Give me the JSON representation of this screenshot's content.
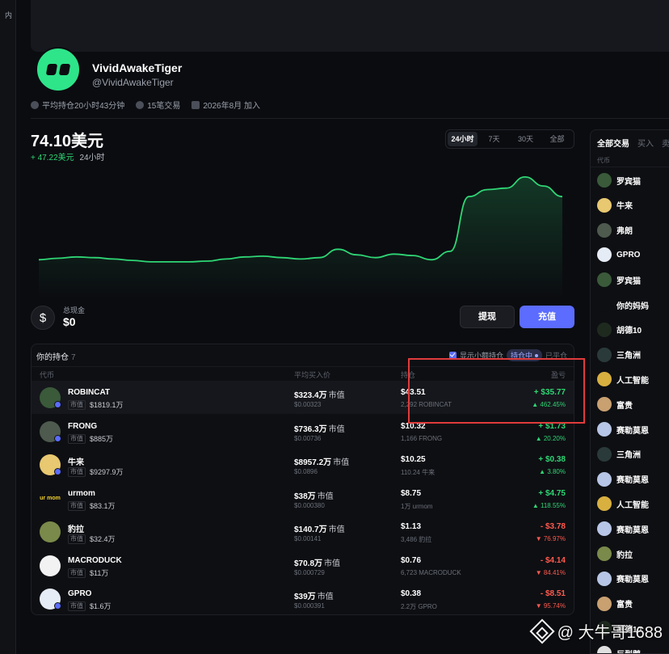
{
  "left_rail": {
    "label": "内"
  },
  "profile": {
    "name": "VividAwakeTiger",
    "handle": "@VividAwakeTiger",
    "avg_hold": "平均持仓20小时43分钟",
    "trades": "15笔交易",
    "joined": "2026年8月 加入"
  },
  "balance": {
    "value": "74.10美元",
    "change": "+ 47.22美元",
    "period": "24小时"
  },
  "range_tabs": [
    "24小时",
    "7天",
    "30天",
    "全部"
  ],
  "chart_data": {
    "type": "line",
    "y": [
      40,
      42,
      44,
      43,
      41,
      39,
      37,
      37,
      37,
      38,
      41,
      44,
      45,
      43,
      41,
      43,
      55,
      47,
      43,
      48,
      46,
      40,
      52,
      130,
      140,
      142,
      158,
      145,
      130
    ],
    "color": "#2fd675"
  },
  "cash": {
    "label": "总现金",
    "value": "$0",
    "icon": "$"
  },
  "buttons": {
    "withdraw": "提现",
    "deposit": "充值"
  },
  "holdings": {
    "title": "你的持仓",
    "count": "7",
    "show_small": "显示小额持仓",
    "filter_active": "持仓中",
    "filter_inactive": "已平仓",
    "columns": {
      "token": "代币",
      "avg": "平均买入价",
      "holding": "持仓",
      "pnl": "盈亏"
    },
    "mcap_tag": "市值",
    "mcap_suffix": "市值",
    "rows": [
      {
        "name": "ROBINCAT",
        "mcap": "$1819.1万",
        "avg": "$323.4万",
        "avg_sub": "$0.00323",
        "hold": "$43.51",
        "hold_sub": "2,292 ROBINCAT",
        "pnl": "+ $35.77",
        "pnl_pct": "▲ 462.45%",
        "sign": "pos",
        "icon_color": "#3a5a3a",
        "badge": true
      },
      {
        "name": "FRONG",
        "mcap": "$885万",
        "avg": "$736.3万",
        "avg_sub": "$0.00736",
        "hold": "$10.32",
        "hold_sub": "1,166 FRONG",
        "pnl": "+ $1.73",
        "pnl_pct": "▲ 20.20%",
        "sign": "pos",
        "icon_color": "#4d5a4d",
        "badge": true
      },
      {
        "name": "牛来",
        "mcap": "$9297.9万",
        "avg": "$8957.2万",
        "avg_sub": "$0.0896",
        "hold": "$10.25",
        "hold_sub": "110.24 牛来",
        "pnl": "+ $0.38",
        "pnl_pct": "▲ 3.80%",
        "sign": "pos",
        "icon_color": "#e8c870",
        "badge": true
      },
      {
        "name": "urmom",
        "mcap": "$83.1万",
        "avg": "$38万",
        "avg_sub": "$0.000380",
        "hold": "$8.75",
        "hold_sub": "1万 urmom",
        "pnl": "+ $4.75",
        "pnl_pct": "▲ 118.55%",
        "sign": "pos",
        "icon_color": "#0e0f13",
        "icon_text": "ur mom",
        "badge": false
      },
      {
        "name": "豹拉",
        "mcap": "$32.4万",
        "avg": "$140.7万",
        "avg_sub": "$0.00141",
        "hold": "$1.13",
        "hold_sub": "3,486 豹拉",
        "pnl": "- $3.78",
        "pnl_pct": "▼ 76.97%",
        "sign": "neg",
        "icon_color": "#7a8a4a",
        "badge": false
      },
      {
        "name": "MACRODUCK",
        "mcap": "$11万",
        "avg": "$70.8万",
        "avg_sub": "$0.000729",
        "hold": "$0.76",
        "hold_sub": "6,723 MACRODUCK",
        "pnl": "- $4.14",
        "pnl_pct": "▼ 84.41%",
        "sign": "neg",
        "icon_color": "#f2f2f2",
        "badge": false
      },
      {
        "name": "GPRO",
        "mcap": "$1.6万",
        "avg": "$39万",
        "avg_sub": "$0.000391",
        "hold": "$0.38",
        "hold_sub": "2.2万 GPRO",
        "pnl": "- $8.51",
        "pnl_pct": "▼ 95.74%",
        "sign": "neg",
        "icon_color": "#e6ecf5",
        "badge": true
      }
    ]
  },
  "right_panel": {
    "tabs": [
      "全部交易",
      "买入",
      "卖"
    ],
    "col": "代币",
    "items": [
      {
        "name": "罗宾猫",
        "color": "#3a5a3a"
      },
      {
        "name": "牛来",
        "color": "#e8c870"
      },
      {
        "name": "弗朗",
        "color": "#4d5a4d"
      },
      {
        "name": "GPRO",
        "color": "#e6ecf5"
      },
      {
        "name": "罗宾猫",
        "color": "#3a5a3a"
      },
      {
        "name": "你的妈妈",
        "color": "#0e0f13"
      },
      {
        "name": "胡德10",
        "color": "#1f2a1f"
      },
      {
        "name": "三角洲",
        "color": "#2a3a3a"
      },
      {
        "name": "人工智能",
        "color": "#d8b040"
      },
      {
        "name": "富贵",
        "color": "#c9a070"
      },
      {
        "name": "赛勒莫恩",
        "color": "#b7c6e6"
      },
      {
        "name": "三角洲",
        "color": "#2a3a3a"
      },
      {
        "name": "赛勒莫恩",
        "color": "#b7c6e6"
      },
      {
        "name": "人工智能",
        "color": "#d8b040"
      },
      {
        "name": "赛勒莫恩",
        "color": "#b7c6e6"
      },
      {
        "name": "豹拉",
        "color": "#7a8a4a"
      },
      {
        "name": "赛勒莫恩",
        "color": "#b7c6e6"
      },
      {
        "name": "富贵",
        "color": "#c9a070"
      },
      {
        "name": "胡德10",
        "color": "#1f2a1f"
      },
      {
        "name": "巨型鹅",
        "color": "#e0e0e0"
      }
    ]
  },
  "watermark": "@ 大牛哥1688"
}
